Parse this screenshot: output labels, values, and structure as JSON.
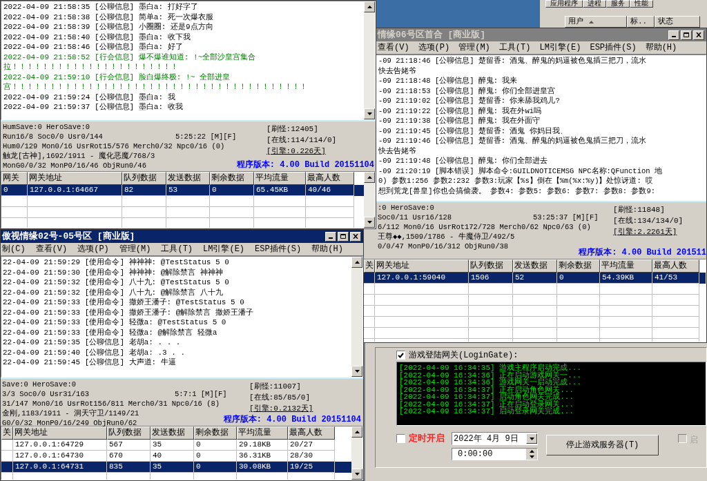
{
  "task_manager": {
    "tabs": [
      "应用程序",
      "进程",
      "服务",
      "性能"
    ],
    "columns": [
      "用户",
      "标..",
      "状态"
    ]
  },
  "server_windows": [
    {
      "log": [
        {
          "text": "2022-04-09 21:58:35 [公聊信息] 墨白a: 打好字了",
          "kind": "normal"
        },
        {
          "text": "2022-04-09 21:58:38 [公聊信息] 简单a: 死一次爆衣服",
          "kind": "normal"
        },
        {
          "text": "2022-04-09 21:58:39 [公聊信息] 小圈圈: 还是9点方向",
          "kind": "normal"
        },
        {
          "text": "2022-04-09 21:58:40 [公聊信息] 墨白a: 收下我",
          "kind": "normal"
        },
        {
          "text": "2022-04-09 21:58:46 [公聊信息] 墨白a: 好了",
          "kind": "normal"
        },
        {
          "text": "2022-04-09 21:58:52 [行会信息] 爆不爆谁知道: !~全部沙皇宫集合",
          "kind": "guild"
        },
        {
          "text": "拉！！！！！！！！！！！！！！！！！！！！！！",
          "kind": "guild"
        },
        {
          "text": "2022-04-09 21:59:10 [行会信息] 脸白爆终极: !~ 全部进皇",
          "kind": "guild"
        },
        {
          "text": "宫！！！！！！！！！！！！！！！！！！！！！！！！！！！！！！！！！！！！！！！",
          "kind": "guild"
        },
        {
          "text": "2022-04-09 21:59:24 [公聊信息] 墨白a: 我",
          "kind": "normal"
        },
        {
          "text": "2022-04-09 21:59:37 [公聊信息] 墨白a: 收我",
          "kind": "normal"
        }
      ],
      "status": {
        "lines": [
          "HumSave:0 HeroSave:0",
          "Run16/8 Soc0/0 Usr0/144",
          "Hum0/129 Mon0/16 UsrRot15/576 Merch0/32 Npc0/16 (0)",
          "触龙[古神],1692/1911 - 魔化恶魔/768/3",
          "MonG0/0/32 MonP0/16/46 ObjRun0/46"
        ],
        "clock": "5:25:22 [M][F]",
        "counters": [
          "[刷怪:12405]",
          "[在线:114/114/0]"
        ],
        "engine": "[引擎:0.226天]",
        "version": "程序版本: 4.00 Build 20151104"
      },
      "table": {
        "columns": [
          "网关",
          "网关地址",
          "队列数据",
          "发送数据",
          "剩余数据",
          "平均流量",
          "最高人数"
        ],
        "rows": [
          {
            "gate": "0",
            "values": [
              "127.0.0.1:64667",
              "82",
              "53",
              "0",
              "65.45KB",
              "40/46"
            ],
            "selected": true
          }
        ]
      }
    },
    {
      "title": "情缘06号区首合 [商业版]",
      "active": false,
      "menu": [
        "查看(V)",
        "选项(P)",
        "管理(M)",
        "工具(T)",
        "LM引擎(E)",
        "ESP插件(S)",
        "帮助(H)"
      ],
      "log": [
        {
          "text": "-09 21:18:46 [公聊信息] 楚留香: 酒鬼、醉鬼的妈逼被色鬼插三把刀，流水",
          "kind": "normal"
        },
        {
          "text": "快去告姥爷",
          "kind": "normal"
        },
        {
          "text": "-09 21:18:48 [公聊信息] 醉鬼: 我来",
          "kind": "normal"
        },
        {
          "text": "-09 21:18:53 [公聊信息] 醉鬼: 你们全部进皇宫",
          "kind": "normal"
        },
        {
          "text": "-09 21:19:02 [公聊信息] 楚留香: 你来舔我鸡儿?",
          "kind": "normal"
        },
        {
          "text": "-09 21:19:22 [公聊信息] 醉鬼: 我在外wi吗",
          "kind": "normal"
        },
        {
          "text": "-09 21:19:38 [公聊信息] 醉鬼: 我在外面守",
          "kind": "normal"
        },
        {
          "text": "-09 21:19:45 [公聊信息] 楚留香: 酒鬼  你妈日我、",
          "kind": "normal"
        },
        {
          "text": "-09 21:19:46 [公聊信息] 楚留香: 酒鬼、醉鬼的妈逼被色鬼插三把刀，流水",
          "kind": "normal"
        },
        {
          "text": "快去告姥爷",
          "kind": "normal"
        },
        {
          "text": "-09 21:19:48 [公聊信息] 醉鬼: 你们全部进去",
          "kind": "normal"
        },
        {
          "text": "-09 21:20:19 [脚本错误] 脚本命令:GUILDNOTICEMSG NPC名称:QFunction 地",
          "kind": "normal"
        },
        {
          "text": "0) 参数1:256 参数2:232 参数3:玩家【%s】倒在【%m(%x:%y)】处惊讶道: 哎",
          "kind": "normal"
        },
        {
          "text": "想到荒龙[兽皇]你也会搞偷袭。 参数4: 参数5: 参数6: 参数7: 参数8: 参数9:",
          "kind": "normal"
        }
      ],
      "status": {
        "lines": [
          ":0 HeroSave:0",
          "Soc0/11 Usr16/128",
          "6/112 Mon0/16 UsrRot172/728 Merch0/62 Npc0/63 (0)",
          "王尊◆◆,1509/1786 - 牛魔侍卫/492/5",
          "0/0/47 MonP0/16/312 ObjRun0/38"
        ],
        "clock": "53:25:37 [M][F]",
        "counters": [
          "[刷怪:11848]",
          "[在线:134/134/0]"
        ],
        "engine": "[引擎:2.2261天]",
        "version": "程序版本: 4.00 Build 201511"
      },
      "table": {
        "columns": [
          "关",
          "网关地址",
          "队列数据",
          "发送数据",
          "剩余数据",
          "平均流量",
          "最高人数"
        ],
        "rows": [
          {
            "values": [
              "127.0.0.1:59040",
              "1506",
              "52",
              "0",
              "54.39KB",
              "41/53"
            ],
            "selected": true
          }
        ]
      }
    },
    {
      "title": "傲视情缘02号-05号区 [商业版]",
      "active": true,
      "menu": [
        "制(C)",
        "查看(V)",
        "选项(P)",
        "管理(M)",
        "工具(T)",
        "LM引擎(E)",
        "ESP插件(S)",
        "帮助(H)"
      ],
      "log": [
        {
          "text": "22-04-09 21:59:29 [使用命令] 神神神: @TestStatus 5 0",
          "kind": "normal"
        },
        {
          "text": "22-04-09 21:59:30 [使用命令] 神神神: @解除禁言 神神神",
          "kind": "normal"
        },
        {
          "text": "22-04-09 21:59:32 [使用命令] 八十九: @TestStatus 5 0",
          "kind": "normal"
        },
        {
          "text": "22-04-09 21:59:32 [使用命令] 八十九: @解除禁言 八十九",
          "kind": "normal"
        },
        {
          "text": "22-04-09 21:59:33 [使用命令] 撒娇王潘子: @TestStatus 5 0",
          "kind": "normal"
        },
        {
          "text": "22-04-09 21:59:33 [使用命令] 撒娇王潘子: @解除禁言 撒娇王潘子",
          "kind": "normal"
        },
        {
          "text": "22-04-09 21:59:33 [使用命令] 轻微a: @TestStatus 5 0",
          "kind": "normal"
        },
        {
          "text": "22-04-09 21:59:33 [使用命令] 轻微a: @解除禁言 轻微a",
          "kind": "normal"
        },
        {
          "text": "22-04-09 21:59:35 [公聊信息] 老胡a: . . .",
          "kind": "normal"
        },
        {
          "text": "22-04-09 21:59:40 [公聊信息] 老胡a: .3 . .",
          "kind": "normal"
        },
        {
          "text": "22-04-09 21:59:45 [公聊信息] 大声道: 牛逼",
          "kind": "normal"
        }
      ],
      "status": {
        "lines": [
          "Save:0 HeroSave:0",
          "3/3 Soc0/0 Usr31/163",
          "31/147 Mon0/16 UsrRot156/811 Merch0/31 Npc0/16 (8)",
          "金刚,1183/1911 - 洞天守卫/1149/21",
          "G0/0/32 MonP0/16/249 ObjRun0/62"
        ],
        "clock": "5:7:1 [M][F]",
        "counters": [
          "[刷怪:11007]",
          "[在线:85/85/0]"
        ],
        "engine": "[引擎:0.2132天]",
        "version": "程序版本: 4.00 Build 20151104"
      },
      "table": {
        "columns": [
          "关",
          "网关地址",
          "队列数据",
          "发送数据",
          "剩余数据",
          "平均流量",
          "最高人数"
        ],
        "rows": [
          {
            "values": [
              "127.0.0.1:64729",
              "567",
              "35",
              "0",
              "29.18KB",
              "20/27"
            ],
            "selected": false
          },
          {
            "values": [
              "127.0.0.1:64730",
              "670",
              "40",
              "0",
              "36.31KB",
              "28/30"
            ],
            "selected": false
          },
          {
            "values": [
              "127.0.0.1:64731",
              "835",
              "35",
              "0",
              "30.08KB",
              "19/25"
            ],
            "selected": true
          }
        ]
      }
    }
  ],
  "launcher": {
    "gate_checkbox": {
      "label": "游戏登陆网关(LoginGate):",
      "checked": true
    },
    "log": [
      "[2022-04-09 16:34:35] 游戏主程序启动完成...",
      "[2022-04-09 16:34:36] 正在启动游戏网关一...",
      "[2022-04-09 16:34:36] 游戏网关一启动完成...",
      "[2022-04-09 16:34:37] 正在启动角色网关...",
      "[2022-04-09 16:34:37] 启动角色网关完成...",
      "[2022-04-09 16:34:37] 正在启动登录网关...",
      "[2022-04-09 16:34:37] 启动登录网关完成..."
    ],
    "schedule_checkbox": {
      "label": "定时开启",
      "checked": false
    },
    "date": "2022年 4月 9日",
    "time": "0:00:00",
    "stop_button": "停止游戏服务器(T)",
    "start_checkbox": {
      "label": "启",
      "checked": false,
      "disabled": true
    }
  }
}
